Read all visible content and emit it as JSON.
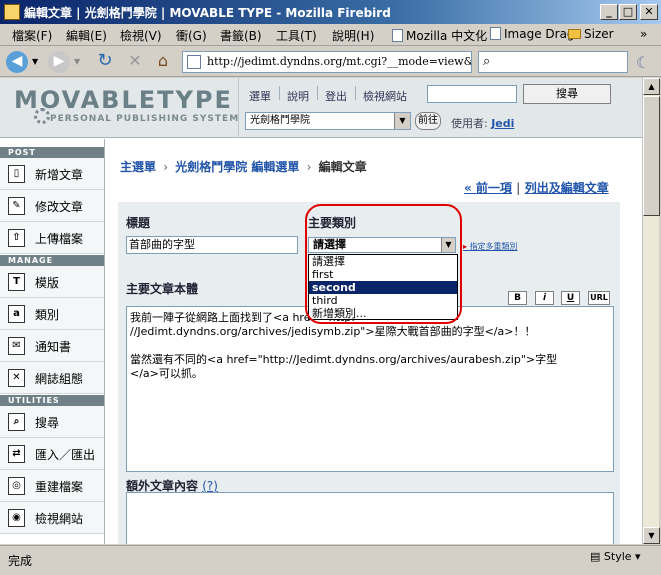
{
  "window": {
    "title": "編輯文章 | 光劍格鬥學院 | MOVABLE TYPE - Mozilla Firebird",
    "min": "_",
    "max": "□",
    "close": "✕"
  },
  "menu": {
    "items": [
      "檔案(F)",
      "編輯(E)",
      "檢視(V)",
      "衝(G)",
      "書籤(B)",
      "工具(T)",
      "說明(H)"
    ],
    "bookmarks": [
      "Mozilla 中文化",
      "Image Drag",
      "Sizer"
    ],
    "overflow": "»"
  },
  "nav": {
    "url": "http://jedimt.dyndns.org/mt.cgi?__mode=view&_ty",
    "search_placeholder": ""
  },
  "header": {
    "logo": "MOVABLETYPE",
    "tagline": "PERSONAL PUBLISHING SYSTEM",
    "links": [
      "選單",
      "說明",
      "登出",
      "檢視網站"
    ],
    "search_button": "搜尋",
    "blog_select": "光劍格鬥學院",
    "go_button": "前往",
    "user_label": "使用者:",
    "user_name": "Jedi"
  },
  "sidebar": {
    "post_head": "POST",
    "manage_head": "MANAGE",
    "utilities_head": "UTILITIES",
    "post_items": [
      {
        "label": "新增文章",
        "icon": "new-post-icon"
      },
      {
        "label": "修改文章",
        "icon": "edit-post-icon"
      },
      {
        "label": "上傳檔案",
        "icon": "upload-icon"
      }
    ],
    "manage_items": [
      {
        "label": "模版",
        "icon": "template-icon"
      },
      {
        "label": "類別",
        "icon": "category-icon"
      },
      {
        "label": "通知書",
        "icon": "mail-icon"
      },
      {
        "label": "網誌組態",
        "icon": "tools-icon"
      }
    ],
    "utility_items": [
      {
        "label": "搜尋",
        "icon": "search-icon"
      },
      {
        "label": "匯入／匯出",
        "icon": "import-export-icon"
      },
      {
        "label": "重建檔案",
        "icon": "rebuild-icon"
      },
      {
        "label": "檢視網站",
        "icon": "view-site-icon"
      }
    ]
  },
  "main": {
    "breadcrumb": [
      "主選單",
      "光劍格鬥學院 編輯選單",
      "編輯文章"
    ],
    "prev_link": "« 前一項",
    "list_link": "列出及編輯文章",
    "title_label": "標題",
    "title_value": "首部曲的字型",
    "category_label": "主要類別",
    "category_selected": "請選擇",
    "multi_category_link": "指定多重類別",
    "category_options": [
      "請選擇",
      "first",
      "second",
      "third",
      "新增類別..."
    ],
    "body_label": "主要文章本體",
    "format_buttons": [
      "B",
      "i",
      "U",
      "URL"
    ],
    "body_lines": [
      "我前一陣子從網路上面找到了<a href=\"http:",
      "//Jedimt.dyndns.org/archives/jedisymb.zip\">星際大戰首部曲的字型</a>！！",
      "當然還有不同的<a href=\"http://Jedimt.dyndns.org/archives/aurabesh.zip\">字型",
      "</a>可以抓。"
    ],
    "extended_label": "額外文章內容",
    "extended_help": "(?)"
  },
  "status": {
    "text": "完成",
    "style_label": "Style"
  }
}
